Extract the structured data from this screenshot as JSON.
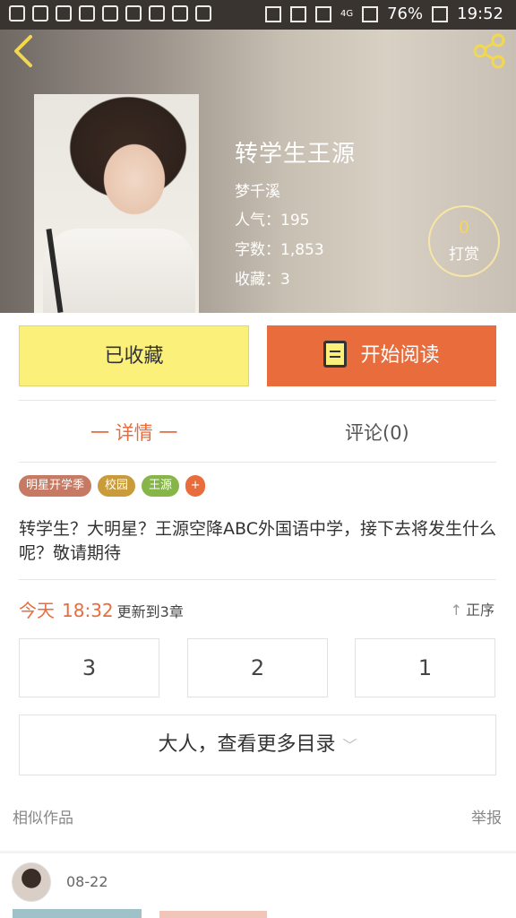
{
  "status_bar": {
    "battery": "76%",
    "time": "19:52",
    "network": "4G"
  },
  "header": {
    "back_icon": "chevron-left-icon",
    "share_icon": "share-icon",
    "title": "转学生王源",
    "author": "梦千溪",
    "popularity": "人气：195",
    "word_count": "字数：1,853",
    "favorites": "收藏：3",
    "tip_count": "0",
    "tip_label": "打赏"
  },
  "actions": {
    "favorited_label": "已收藏",
    "read_label": "开始阅读",
    "read_icon": "book-icon"
  },
  "tabs": {
    "details": "一 详情 一",
    "comments": "评论(0)"
  },
  "tags": [
    "明星开学季",
    "校园",
    "王源",
    "+"
  ],
  "description": "转学生？大明星？王源空降ABC外国语中学，接下去将发生什么呢？敬请期待",
  "update": {
    "day": "今天",
    "time": "18:32",
    "note": "更新到3章",
    "sort_label": "正序"
  },
  "chapters": [
    "3",
    "2",
    "1"
  ],
  "more_catalog": "大人，查看更多目录",
  "similar_label": "相似作品",
  "report_label": "举报",
  "feed": {
    "date": "08-22"
  },
  "colors": {
    "accent": "#e86c3c",
    "favorite_button": "#fbf17a",
    "status_bar": "#3a3431"
  }
}
